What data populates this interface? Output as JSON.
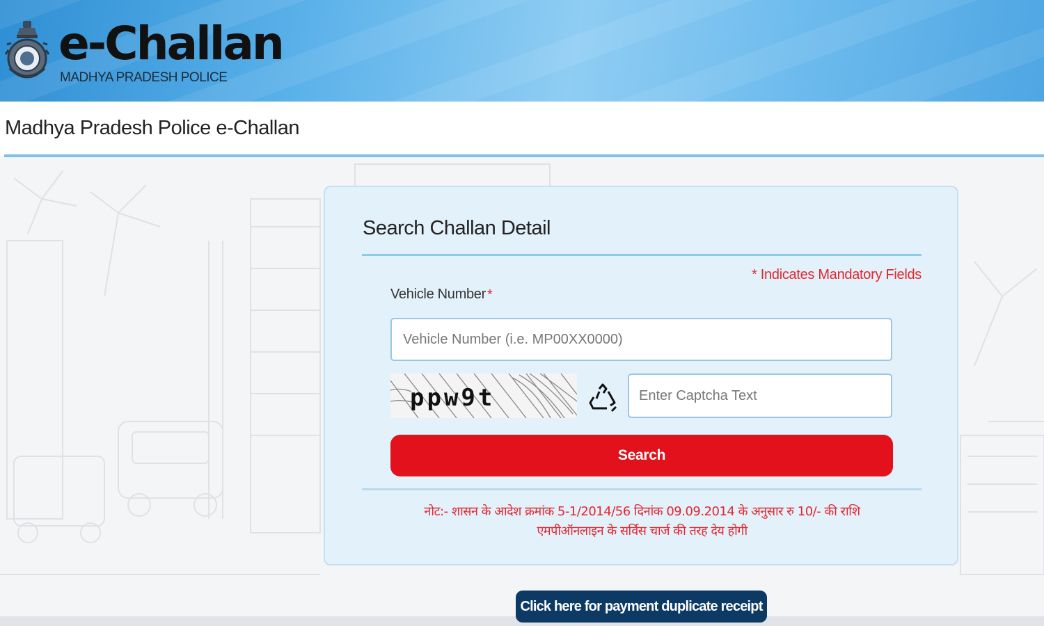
{
  "header": {
    "logo_title": "e-Challan",
    "logo_subtitle": "MADHYA PRADESH POLICE"
  },
  "page": {
    "title": "Madhya Pradesh Police e-Challan"
  },
  "form": {
    "title": "Search Challan Detail",
    "mandatory_note": "* Indicates Mandatory Fields",
    "vehicle_label": "Vehicle Number",
    "required_marker": "*",
    "vehicle_placeholder": "Vehicle Number (i.e. MP00XX0000)",
    "captcha_text": "ppw9t",
    "captcha_placeholder": "Enter Captcha Text",
    "search_label": "Search",
    "hindi_note_line1": "नोट:- शासन के आदेश क्रमांक 5-1/2014/56 दिनांक 09.09.2014 के अनुसार रु 10/- की राशि",
    "hindi_note_line2": "एमपीऑनलाइन के सर्विस चार्ज की तरह देय होगी"
  },
  "footer": {
    "receipt_button": "Click here for payment duplicate receipt"
  },
  "colors": {
    "header_blue": "#5cb2ea",
    "accent_rule": "#7cc1e6",
    "card_bg": "#e3f1fb",
    "danger_red": "#e3111b",
    "receipt_navy": "#0c3a64"
  }
}
